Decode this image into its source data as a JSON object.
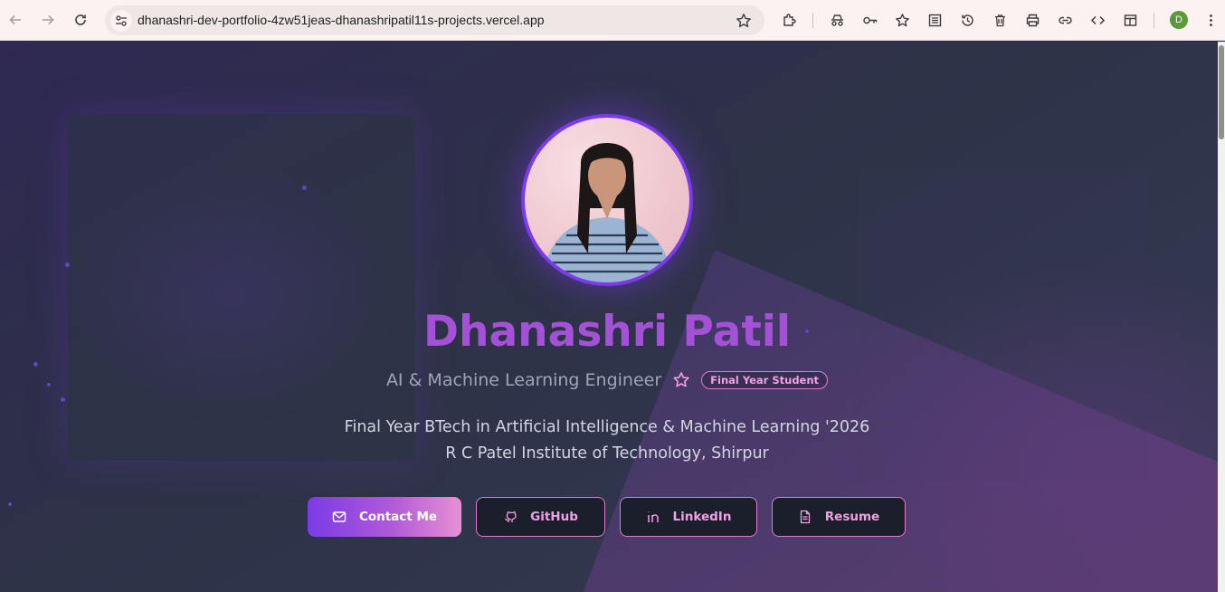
{
  "browser": {
    "url": "dhanashri-dev-portfolio-4zw51jeas-dhanashripatil11s-projects.vercel.app",
    "profile_initial": "D",
    "nav_icons": [
      "back-arrow-icon",
      "forward-arrow-icon",
      "reload-icon"
    ],
    "toolbar_icons": [
      "extensions-icon",
      "incognito-icon",
      "key-icon",
      "bookmarks-icon",
      "reading-list-icon",
      "history-icon",
      "delete-icon",
      "print-icon",
      "link-icon",
      "code-icon",
      "side-panel-icon",
      "menu-dots-icon"
    ]
  },
  "hero": {
    "name": "Dhanashri Patil",
    "subtitle": "AI & Machine Learning Engineer",
    "badge": "Final Year Student",
    "desc_line1": "Final Year BTech in Artificial Intelligence & Machine Learning '2026",
    "desc_line2": "R C Patel Institute of Technology, Shirpur"
  },
  "buttons": {
    "contact": "Contact Me",
    "github": "GitHub",
    "linkedin": "LinkedIn",
    "resume": "Resume"
  },
  "colors": {
    "accent": "#7c3aed",
    "name": "#a352d6",
    "badge": "#e07ccf",
    "background": "#2e3247"
  }
}
